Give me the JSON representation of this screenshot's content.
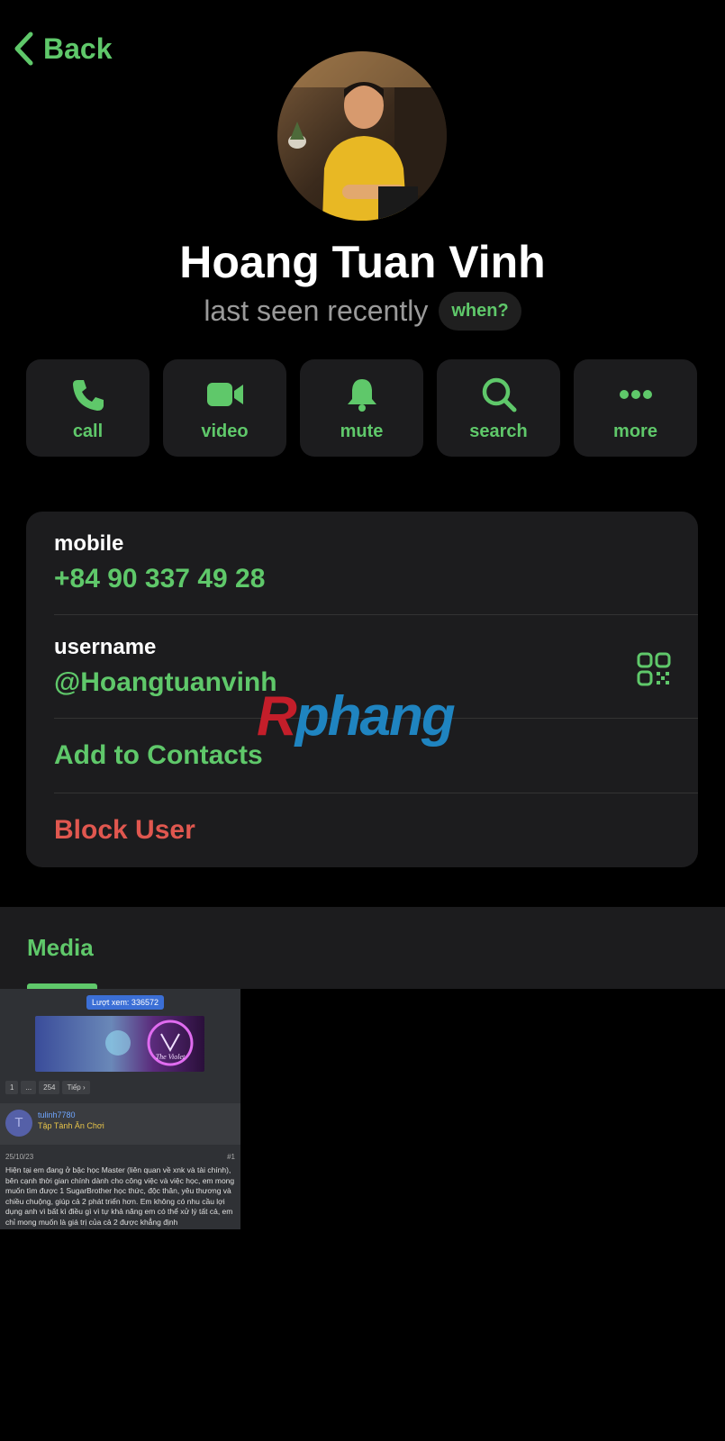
{
  "nav": {
    "back_label": "Back"
  },
  "profile": {
    "name": "Hoang Tuan Vinh",
    "status": "last seen recently",
    "when_label": "when?"
  },
  "actions": [
    {
      "label": "call",
      "icon": "phone-icon"
    },
    {
      "label": "video",
      "icon": "video-camera-icon"
    },
    {
      "label": "mute",
      "icon": "bell-icon"
    },
    {
      "label": "search",
      "icon": "magnifier-icon"
    },
    {
      "label": "more",
      "icon": "ellipsis-icon"
    }
  ],
  "info": {
    "mobile_label": "mobile",
    "mobile_value": "+84 90 337 49 28",
    "username_label": "username",
    "username_value": "@Hoangtuanvinh",
    "qr_icon": "qr-code-icon",
    "add_contacts": "Add to Contacts",
    "block_user": "Block User"
  },
  "watermark": {
    "r": "R",
    "rest": "phang"
  },
  "media": {
    "tab_label": "Media",
    "thumbnail": {
      "views": "Lượt xem: 336572",
      "banner_text": "The Violet",
      "pager": [
        "1",
        "...",
        "254",
        "Tiếp ›"
      ],
      "avatar_letter": "T",
      "username": "tulinh7780",
      "rank": "Tập Tành Ăn Chơi",
      "date": "25/10/23",
      "post_no": "#1",
      "body": "Hiện tại em đang ở bậc học Master (liên quan về xnk và tài chính), bên cạnh thời gian chính dành cho công việc và việc học, em mong muốn tìm được 1 SugarBrother học thức, độc thân, yêu thương và chiều chuộng, giúp cả 2 phát triển hơn. Em không có nhu cầu lợi dụng anh vì bất kì điều gì vì tự khả năng em có thể xử lý tất cả, em chỉ mong muốn là giá trị của cả 2 được khẳng định"
    }
  },
  "colors": {
    "accent": "#5fc86a",
    "danger": "#e0574f",
    "card": "#1c1c1e",
    "background": "#000000",
    "secondary_text": "#9a9a9a"
  }
}
